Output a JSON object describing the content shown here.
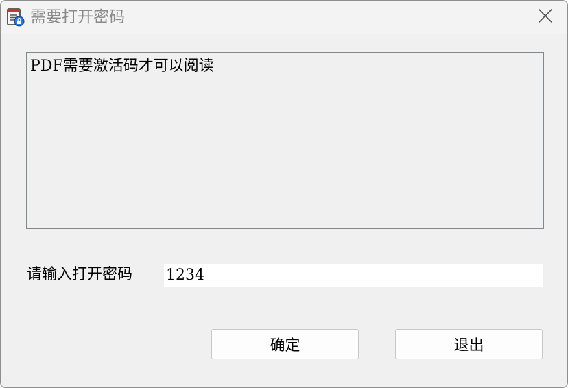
{
  "window": {
    "title": "需要打开密码",
    "icon": "pdf-lock-icon",
    "close_icon": "close-icon"
  },
  "message": {
    "text": "PDF需要激活码才可以阅读"
  },
  "password": {
    "label": "请输入打开密码",
    "value": "1234"
  },
  "buttons": {
    "ok_label": "确定",
    "exit_label": "退出"
  },
  "colors": {
    "dialog_bg": "#f0f0f0",
    "title_text": "#8a8a8a",
    "border": "#828790",
    "button_bg": "#fdfdfd"
  }
}
